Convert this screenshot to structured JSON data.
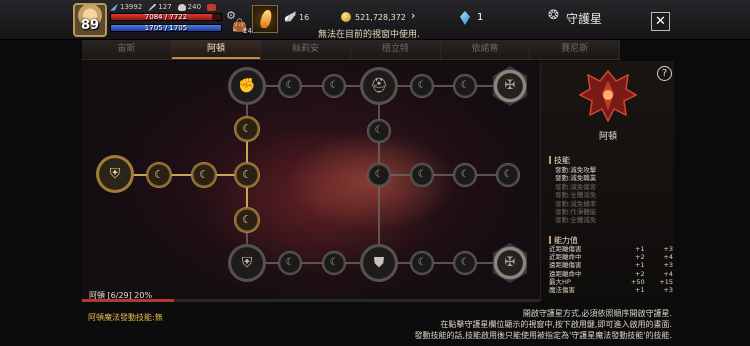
{
  "player": {
    "level": "89",
    "stat1": "13992",
    "stat2": "127",
    "stat3": "240",
    "hp_text": "7084 / 7722",
    "hp_fraction": 0.917,
    "mp_text": "1705 / 1705",
    "mp_fraction": 1.0
  },
  "bag_count": "24",
  "wings_count": "16",
  "gold": "521,728,372",
  "notice": "無法在目前的視窗中使用.",
  "gems": "1",
  "window_title": "守護星",
  "tabs": [
    {
      "label": "宙斯"
    },
    {
      "label": "阿頓"
    },
    {
      "label": "絲莉安"
    },
    {
      "label": "梧立特"
    },
    {
      "label": "依諾蒂"
    },
    {
      "label": "賽尼斯"
    }
  ],
  "active_tab": 1,
  "progress": {
    "label": "阿頓 [6/29] 20%",
    "fraction": 0.2
  },
  "panel": {
    "emblem_name": "阿頓",
    "skills_title": "技能",
    "skills": [
      "發動:減免攻擊",
      "發動:減免職業",
      "發動:減免傷害",
      "發動:全體減免",
      "發動:減免機率",
      "發動:作渾體能",
      "發動:全體減免"
    ],
    "stats_title": "能力值",
    "stats": [
      {
        "name": "近距離傷害",
        "cur": "+1",
        "max": "+3"
      },
      {
        "name": "近距離命中",
        "cur": "+2",
        "max": "+4"
      },
      {
        "name": "遠距離傷害",
        "cur": "+1",
        "max": "+3"
      },
      {
        "name": "遠距離命中",
        "cur": "+2",
        "max": "+4"
      },
      {
        "name": "最大HP",
        "cur": "+50",
        "max": "+15"
      },
      {
        "name": "魔法傷害",
        "cur": "+1",
        "max": "+3"
      }
    ]
  },
  "footer": {
    "left": "阿頓魔法發動技能:無",
    "lines": [
      "開啟守護星方式,必須依照順序開啟守護星.",
      "在點擊守護星欄位顯示的視窗中,按下啟用鍵,即可進入啟用的畫面.",
      "發動技能的話,技能啟用後只能使用被指定為'守護星魔法發動技能'的技能."
    ]
  },
  "colors": {
    "accent_gold": "#e2c27a",
    "hp_red": "#e23a3a",
    "mp_blue": "#4d7de6",
    "progress_red": "#b23a2a",
    "footer_yellow": "#e4b84e"
  }
}
